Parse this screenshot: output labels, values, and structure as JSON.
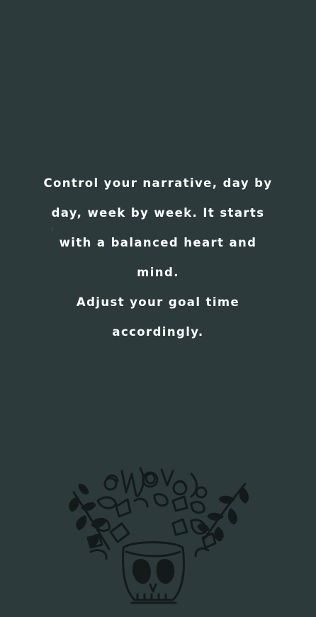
{
  "background_color": "#2c3a3b",
  "text_color": "#ffffff",
  "ink_color": "#141a1a",
  "message": {
    "paragraph_1": "Control your narrative, day by day, week by week. It starts with a balanced heart and mind.",
    "paragraph_2": "Adjust your goal time accordingly."
  },
  "illustration_icon": "floral-skull-pot-illustration"
}
